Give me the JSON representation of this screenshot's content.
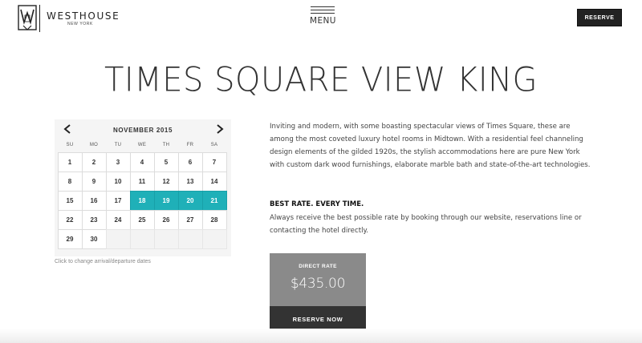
{
  "brand": {
    "name": "WESTHOUSE",
    "location": "NEW YORK"
  },
  "header": {
    "menu_label": "MENU",
    "reserve_label": "RESERVE"
  },
  "room": {
    "title": "TIMES SQUARE VIEW KING",
    "description": "Inviting and modern, with some boasting spectacular views of Times Square, these are among the most coveted luxury hotel rooms in Midtown. With a residential feel channeling design elements of the gilded 1920s, the stylish accommodations here are pure New York with custom dark wood furnishings, elaborate marble bath and state-of-the-art technologies.",
    "rate_heading": "BEST RATE. EVERY TIME.",
    "rate_text": "Always receive the best possible rate by booking through our website, reservations line or contacting the hotel directly."
  },
  "calendar": {
    "month": "NOVEMBER 2015",
    "weekdays": [
      "SU",
      "MO",
      "TU",
      "WE",
      "TH",
      "FR",
      "SA"
    ],
    "days": [
      "1",
      "2",
      "3",
      "4",
      "5",
      "6",
      "7",
      "8",
      "9",
      "10",
      "11",
      "12",
      "13",
      "14",
      "15",
      "16",
      "17",
      "18",
      "19",
      "20",
      "21",
      "22",
      "23",
      "24",
      "25",
      "26",
      "27",
      "28",
      "29",
      "30"
    ],
    "selected": [
      "18",
      "19",
      "20",
      "21"
    ],
    "note": "Click to change arrival/departure dates",
    "accent_color": "#1fb0b8"
  },
  "rate": {
    "label": "DIRECT RATE",
    "price": "$435.00",
    "cta": "RESERVE NOW"
  }
}
